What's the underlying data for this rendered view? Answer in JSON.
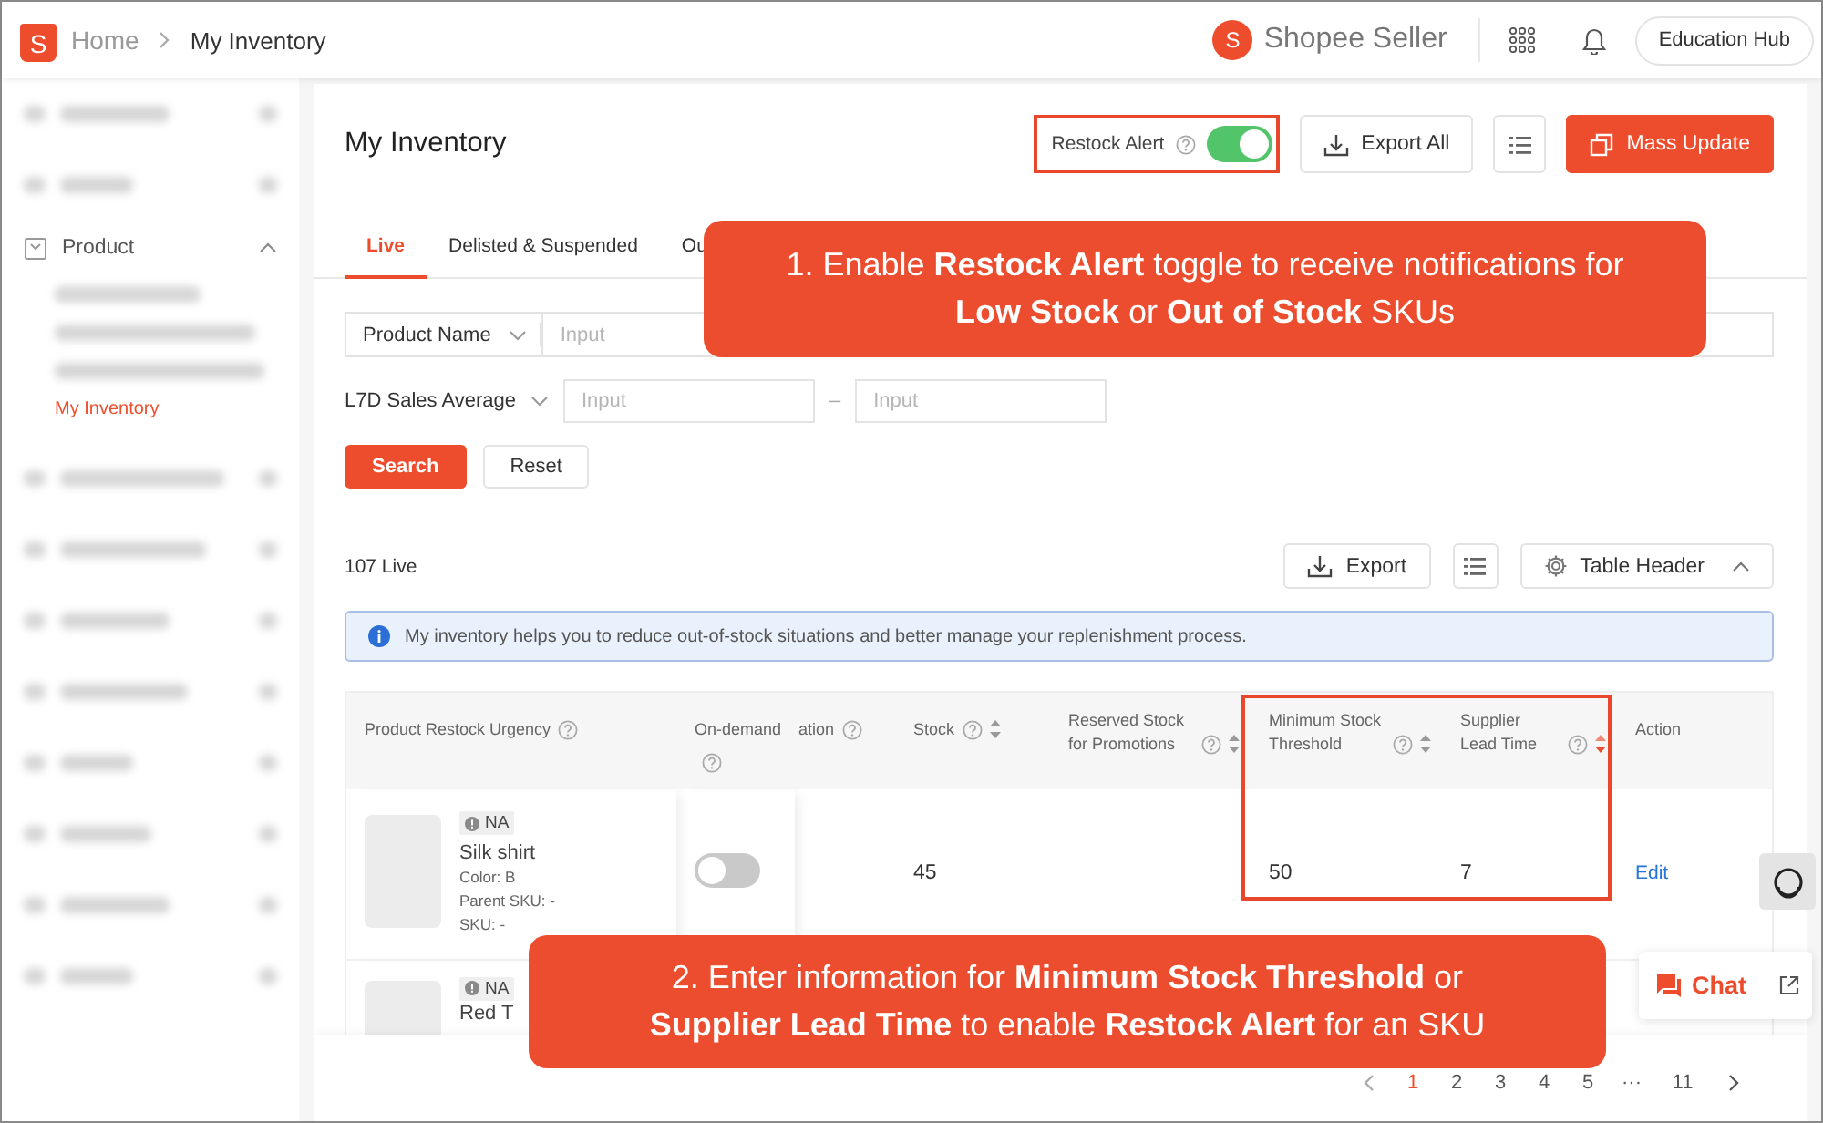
{
  "topbar": {
    "logo": "S",
    "home": "Home",
    "page": "My Inventory",
    "brand_logo": "S",
    "brand": "Shopee Seller",
    "hub_button": "Education Hub"
  },
  "sidebar": {
    "items": [
      {
        "kind": "blurred"
      },
      {
        "kind": "blurred"
      },
      {
        "kind": "group",
        "label": "Product",
        "expanded": true,
        "children": [
          {
            "kind": "blurred",
            "selected": false
          },
          {
            "kind": "blurred",
            "selected": false
          },
          {
            "kind": "blurred",
            "selected": false
          },
          {
            "kind": "link",
            "label": "My Inventory",
            "selected": true
          }
        ]
      },
      {
        "kind": "blurred"
      },
      {
        "kind": "blurred"
      },
      {
        "kind": "blurred"
      },
      {
        "kind": "blurred"
      },
      {
        "kind": "blurred"
      },
      {
        "kind": "blurred"
      },
      {
        "kind": "blurred"
      },
      {
        "kind": "blurred"
      }
    ]
  },
  "panel": {
    "title": "My Inventory",
    "restock_alert": {
      "label": "Restock Alert",
      "on": true,
      "highlighted": true
    },
    "actions": [
      {
        "kind": "download",
        "label": "Export All"
      },
      {
        "kind": "list"
      },
      {
        "kind": "primary",
        "label": "Mass Update"
      }
    ],
    "tabs": [
      {
        "label": "Live",
        "selected": true
      },
      {
        "label": "Delisted & Suspended",
        "selected": false
      },
      {
        "label": "Ou",
        "selected": false
      }
    ],
    "filters": {
      "search_type": "Product Name",
      "search_placeholder": "Input",
      "range_type": "L7D Sales Average",
      "range_min_placeholder": "Input",
      "range_separator": "–",
      "range_max_placeholder": "Input"
    },
    "filter_buttons": [
      {
        "kind": "primary",
        "label": "Search"
      },
      {
        "kind": "outline",
        "label": "Reset"
      }
    ],
    "count": "107 Live",
    "tools": [
      {
        "kind": "download",
        "label": "Export"
      },
      {
        "kind": "list"
      },
      {
        "kind": "settings",
        "label": "Table Header"
      }
    ],
    "banner": "My inventory helps you to reduce out-of-stock situations and better manage your replenishment process.",
    "table": {
      "columns": [
        {
          "label": "Product Restock Urgency",
          "help": true,
          "sortable": false,
          "highlighted": false
        },
        {
          "label": "On-demand",
          "help": true,
          "sortable": false,
          "highlighted": false
        },
        {
          "label": "ation",
          "help": true,
          "sortable": false,
          "highlighted": false
        },
        {
          "label": "Stock",
          "help": true,
          "sortable": true,
          "sorted": false,
          "highlighted": false
        },
        {
          "label": "Reserved Stock for Promotions",
          "help": true,
          "sortable": true,
          "sorted": false,
          "highlighted": false
        },
        {
          "label": "Minimum Stock Threshold",
          "help": true,
          "sortable": true,
          "sorted": false,
          "highlighted": true
        },
        {
          "label": "Supplier Lead Time",
          "help": true,
          "sortable": true,
          "sorted": true,
          "highlighted": true
        },
        {
          "label": "Action",
          "help": false,
          "sortable": false,
          "highlighted": false
        }
      ],
      "rows": [
        {
          "urgency": "NA",
          "name": "Silk shirt",
          "details": [
            "Color: B",
            "Parent SKU: -",
            "SKU: -"
          ],
          "on_demand": false,
          "stock": "45",
          "minimum_stock": "50",
          "lead_time": "7",
          "action": "Edit"
        },
        {
          "urgency": "NA",
          "name": "Red T"
        }
      ]
    },
    "pagination": {
      "pages": [
        {
          "label": "1",
          "selected": true
        },
        {
          "label": "2",
          "selected": false
        },
        {
          "label": "3",
          "selected": false
        },
        {
          "label": "4",
          "selected": false
        },
        {
          "label": "5",
          "selected": false
        },
        {
          "label": "···",
          "selected": false
        },
        {
          "label": "11",
          "selected": false
        }
      ]
    }
  },
  "callouts": [
    {
      "text": "1. Enable **Restock Alert** toggle to receive notifications for **Low Stock** or **Out of Stock** SKUs"
    },
    {
      "text": "2. Enter information for **Minimum Stock Threshold** or **Supplier Lead Time** to enable **Restock Alert** for an SKU"
    }
  ],
  "chat": {
    "label": "Chat"
  }
}
